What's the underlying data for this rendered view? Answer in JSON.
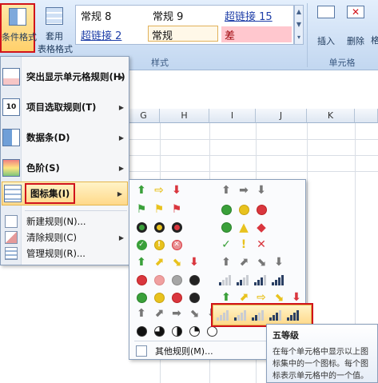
{
  "ribbon": {
    "conditional_format_label": "条件格式",
    "apply_table_label": "套用",
    "apply_table_label2": "表格格式",
    "styles_group_label": "样式",
    "cells_group_label": "单元格",
    "insert_label": "插入",
    "delete_label": "删除",
    "format_label": "格",
    "styles": [
      "常规 8",
      "常规 9",
      "超链接 15",
      "超链接 2",
      "常规",
      "差"
    ]
  },
  "columns": [
    "G",
    "H",
    "I",
    "J",
    "K"
  ],
  "menu": {
    "items": [
      {
        "label": "突出显示单元格规则(H)"
      },
      {
        "label": "项目选取规则(T)"
      },
      {
        "label": "数据条(D)"
      },
      {
        "label": "色阶(S)"
      },
      {
        "label": "图标集(I)"
      },
      {
        "label": "新建规则(N)..."
      },
      {
        "label": "清除规则(C)"
      },
      {
        "label": "管理规则(R)..."
      }
    ]
  },
  "submenu": {
    "other_rules": "其他规则(M)..."
  },
  "tooltip": {
    "title": "五等级",
    "body": "在每个单元格中显示以上图标集中的一个图标。每个图标表示单元格中的一个值。"
  },
  "colors": {
    "red_highlight": "#d1131b",
    "green": "#3aa03a",
    "yellow": "#e8c21e",
    "red": "#d9363e"
  }
}
